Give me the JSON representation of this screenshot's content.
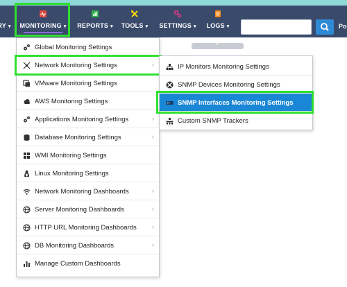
{
  "navbar": {
    "items": [
      {
        "label": "RY",
        "icon": "inventory-icon"
      },
      {
        "label": "MONITORING",
        "icon": "monitoring-icon"
      },
      {
        "label": "REPORTS",
        "icon": "reports-icon"
      },
      {
        "label": "TOOLS",
        "icon": "tools-icon"
      },
      {
        "label": "SETTINGS",
        "icon": "settings-icon"
      },
      {
        "label": "LOGS",
        "icon": "logs-icon"
      }
    ],
    "search_placeholder": "",
    "user_label": "Pol",
    "active_underline_color": "#8e6bd8",
    "background_color": "#3a4a6b"
  },
  "monitoring_menu": {
    "items": [
      {
        "label": "Global Monitoring Settings",
        "icon": "gears-icon",
        "has_submenu": false
      },
      {
        "label": "Network Monitoring Settings",
        "icon": "network-icon",
        "has_submenu": true
      },
      {
        "label": "VMware Monitoring Settings",
        "icon": "vmware-icon",
        "has_submenu": false
      },
      {
        "label": "AWS Monitoring Settings",
        "icon": "cloud-icon",
        "has_submenu": false
      },
      {
        "label": "Applications Monitoring Settings",
        "icon": "gears-icon",
        "has_submenu": true
      },
      {
        "label": "Database Monitoring Settings",
        "icon": "database-icon",
        "has_submenu": true
      },
      {
        "label": "WMI Monitoring Settings",
        "icon": "windows-icon",
        "has_submenu": false
      },
      {
        "label": "Linux Monitoring Settings",
        "icon": "linux-icon",
        "has_submenu": false
      },
      {
        "label": "Network Monitoring Dashboards",
        "icon": "wifi-icon",
        "has_submenu": true
      },
      {
        "label": "Server Monitoring Dashboards",
        "icon": "globe-icon",
        "has_submenu": true
      },
      {
        "label": "HTTP URL Monitoring Dashboards",
        "icon": "globe-icon",
        "has_submenu": true
      },
      {
        "label": "DB Monitoring Dashboards",
        "icon": "globe-icon",
        "has_submenu": true
      },
      {
        "label": "Manage Custom Dashboards",
        "icon": "bar-chart-icon",
        "has_submenu": false
      }
    ]
  },
  "network_submenu": {
    "items": [
      {
        "label": "IP Monitors Monitoring Settings",
        "icon": "sitemap-icon"
      },
      {
        "label": "SNMP Devices Monitoring Settings",
        "icon": "snmp-device-icon"
      },
      {
        "label": "SNMP Interfaces Monitoring Settings",
        "icon": "interface-icon",
        "selected": true
      },
      {
        "label": "Custom SNMP Trackers",
        "icon": "tracker-icon"
      }
    ],
    "selected_color": "#1a87d6"
  },
  "highlight_color": "#2fe02f"
}
